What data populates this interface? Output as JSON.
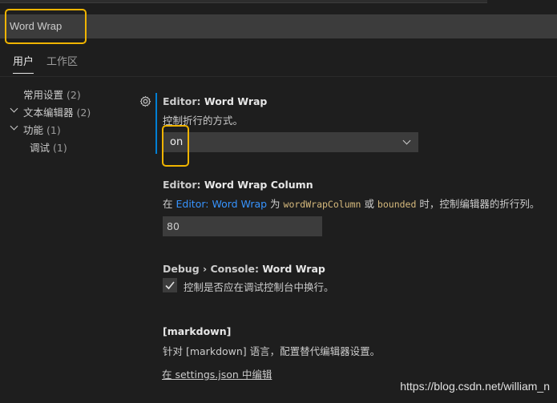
{
  "search": {
    "value": "Word Wrap"
  },
  "tabs": [
    {
      "label": "用户"
    },
    {
      "label": "工作区"
    }
  ],
  "tree": [
    {
      "label": "常用设置",
      "count": "(2)"
    },
    {
      "label": "文本编辑器",
      "count": "(2)"
    },
    {
      "label": "功能",
      "count": "(1)"
    },
    {
      "label": "调试",
      "count": "(1)"
    }
  ],
  "settings": {
    "word_wrap": {
      "category": "Editor: ",
      "name": "Word Wrap",
      "description": "控制折行的方式。",
      "value": "on"
    },
    "word_wrap_column": {
      "category": "Editor: ",
      "name": "Word Wrap Column",
      "desc_prefix": "在 ",
      "desc_link": "Editor: Word Wrap",
      "desc_mid1": " 为 ",
      "desc_code1": "wordWrapColumn",
      "desc_mid2": " 或 ",
      "desc_code2": "bounded",
      "desc_suffix": " 时，控制编辑器的折行列。",
      "value": "80"
    },
    "console_word_wrap": {
      "category": "Debug › Console: ",
      "name": "Word Wrap",
      "description": "控制是否应在调试控制台中换行。",
      "checked": true
    },
    "markdown": {
      "title": "[markdown]",
      "description": "针对 [markdown] 语言，配置替代编辑器设置。",
      "link": "在 settings.json 中编辑"
    }
  },
  "watermark": "https://blog.csdn.net/william_n",
  "colors": {
    "background": "#1e1e1e",
    "input_background": "#3c3c3c",
    "link": "#3794ff",
    "focus": "#007fd4",
    "highlight": "#f0b400"
  },
  "icons": [
    "gear-icon",
    "chevron-down-icon",
    "check-icon"
  ]
}
